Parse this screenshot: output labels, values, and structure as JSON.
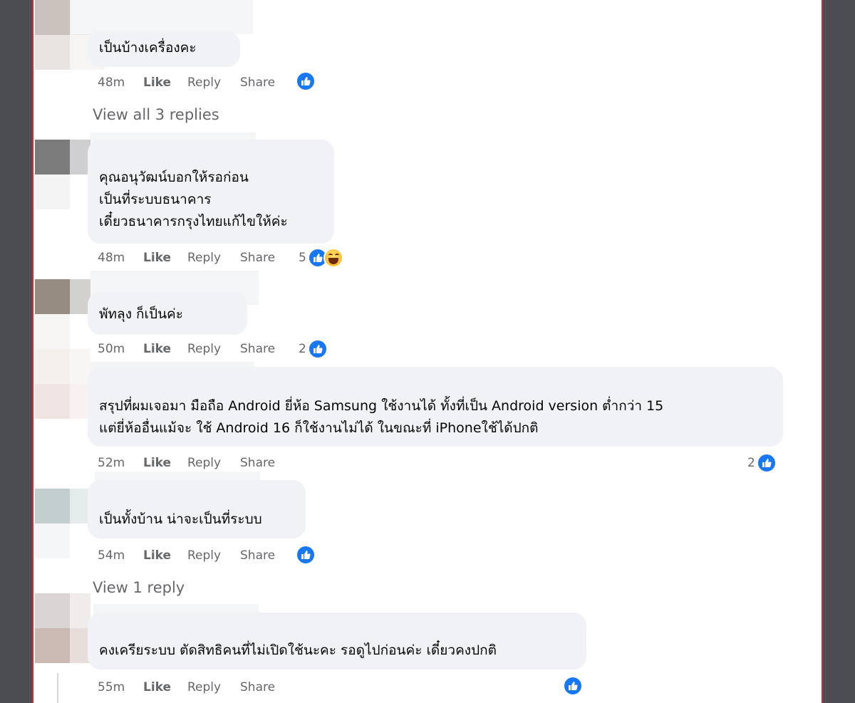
{
  "comments": [
    {
      "lines": [
        "เป็นบ้างเครื่องคะ"
      ],
      "time": "48m",
      "like": "Like",
      "reply": "Reply",
      "share": "Share",
      "reaction_count": ""
    },
    {
      "lines": [
        "คุณอนุวัฒน์บอกให้รอก่อน",
        "เป็นที่ระบบธนาคาร",
        "เดี๋ยวธนาคารกรุงไทยแก้ไขให้ค่ะ"
      ],
      "time": "48m",
      "like": "Like",
      "reply": "Reply",
      "share": "Share",
      "reaction_count": "5"
    },
    {
      "lines": [
        "พัทลุง ก็เป็นค่ะ"
      ],
      "time": "50m",
      "like": "Like",
      "reply": "Reply",
      "share": "Share",
      "reaction_count": "2"
    },
    {
      "lines": [
        "สรุปที่ผมเจอมา มือถือ Android ยี่ห้อ Samsung ใช้งานได้ ทั้งที่เป็น Android version ต่ำกว่า 15",
        "แต่ยี่ห้ออื่นแม้จะ ใช้ Android 16 ก็ใช้งานไม่ได้ ในขณะที่ iPhoneใช้ได้ปกติ"
      ],
      "time": "52m",
      "like": "Like",
      "reply": "Reply",
      "share": "Share",
      "reaction_count": "2"
    },
    {
      "lines": [
        "เป็นทั้งบ้าน น่าจะเป็นที่ระบบ"
      ],
      "time": "54m",
      "like": "Like",
      "reply": "Reply",
      "share": "Share",
      "reaction_count": ""
    },
    {
      "lines": [
        "คงเครียระบบ ตัดสิทธิคนที่ไม่เปิดใช้นะคะ รอดูไปก่อนค่ะ เดี๋ยวคงปกติ"
      ],
      "time": "55m",
      "like": "Like",
      "reply": "Reply",
      "share": "Share",
      "reaction_count": ""
    }
  ],
  "view_replies": [
    "View all 3 replies",
    "View 1 reply"
  ],
  "colors": {
    "accent": "#1877f2",
    "bubble": "#f0f2f5",
    "meta_text": "#65676b",
    "border": "#d32a2a"
  },
  "icons": [
    "like-thumb-icon",
    "haha-emoji-icon"
  ]
}
